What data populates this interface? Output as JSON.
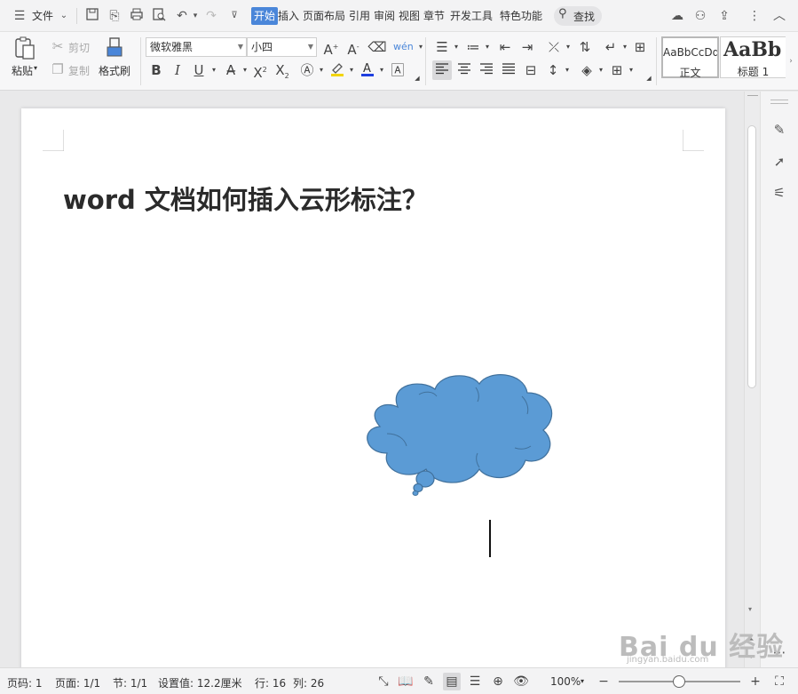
{
  "menubar": {
    "file_label": "文件",
    "tabs": [
      {
        "label": "开始",
        "active": true
      },
      {
        "label": "插入"
      },
      {
        "label": "页面布局"
      },
      {
        "label": "引用"
      },
      {
        "label": "审阅"
      },
      {
        "label": "视图"
      },
      {
        "label": "章节"
      },
      {
        "label": "开发工具"
      },
      {
        "label": "特色功能"
      }
    ],
    "search_label": "查找"
  },
  "ribbon": {
    "paste_label": "粘贴",
    "cut_label": "剪切",
    "copy_label": "复制",
    "format_painter_label": "格式刷",
    "font_name": "微软雅黑",
    "font_size": "小四",
    "styles": [
      {
        "sample": "AaBbCcDd",
        "name": "正文"
      },
      {
        "sample": "AaBb",
        "name": "标题 1"
      }
    ]
  },
  "document": {
    "title": "word 文档如何插入云形标注？",
    "shape": {
      "type": "cloud-callout",
      "fill": "#5b9bd5",
      "stroke": "#41719c"
    }
  },
  "statusbar": {
    "page_num": "页码: 1",
    "page_count": "页面: 1/1",
    "section": "节: 1/1",
    "setting": "设置值: 12.2厘米",
    "row": "行: 16",
    "col": "列: 26",
    "zoom": "100%"
  },
  "watermark": {
    "text": "Bai du 经验",
    "sub": "jingyan.baidu.com"
  },
  "colors": {
    "accent": "#4a86d9",
    "page_bg": "#ffffff",
    "workspace": "#e9e9ea"
  }
}
